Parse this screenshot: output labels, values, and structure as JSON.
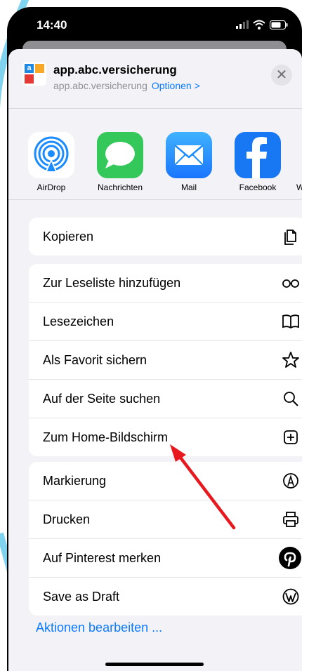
{
  "status": {
    "time": "14:40"
  },
  "sheet": {
    "title": "app.abc.versicherung",
    "subtitle": "app.abc.versicherung",
    "options_label": "Optionen >",
    "app_icon_letter": "a"
  },
  "share_targets": [
    {
      "label": "AirDrop",
      "icon": "airdrop-icon",
      "color": "#ffffff"
    },
    {
      "label": "Nachrichten",
      "icon": "messages-icon",
      "color": "#34c759"
    },
    {
      "label": "Mail",
      "icon": "mail-icon",
      "color": "#1a8cff"
    },
    {
      "label": "Facebook",
      "icon": "facebook-icon",
      "color": "#1877f2"
    },
    {
      "label": "W",
      "icon": "whatsapp-icon",
      "color": "#25d366"
    }
  ],
  "actions": {
    "group1": [
      {
        "label": "Kopieren",
        "icon": "copy-icon"
      }
    ],
    "group2": [
      {
        "label": "Zur Leseliste hinzufügen",
        "icon": "glasses-icon"
      },
      {
        "label": "Lesezeichen",
        "icon": "book-icon"
      },
      {
        "label": "Als Favorit sichern",
        "icon": "star-icon"
      },
      {
        "label": "Auf der Seite suchen",
        "icon": "search-icon"
      },
      {
        "label": "Zum Home-Bildschirm",
        "icon": "add-square-icon"
      }
    ],
    "group3": [
      {
        "label": "Markierung",
        "icon": "markup-icon"
      },
      {
        "label": "Drucken",
        "icon": "printer-icon"
      },
      {
        "label": "Auf Pinterest merken",
        "icon": "pinterest-icon"
      },
      {
        "label": "Save as Draft",
        "icon": "wordpress-icon"
      }
    ]
  },
  "edit_actions_label": "Aktionen bearbeiten ...",
  "annotation": {
    "color": "#e8191e"
  }
}
